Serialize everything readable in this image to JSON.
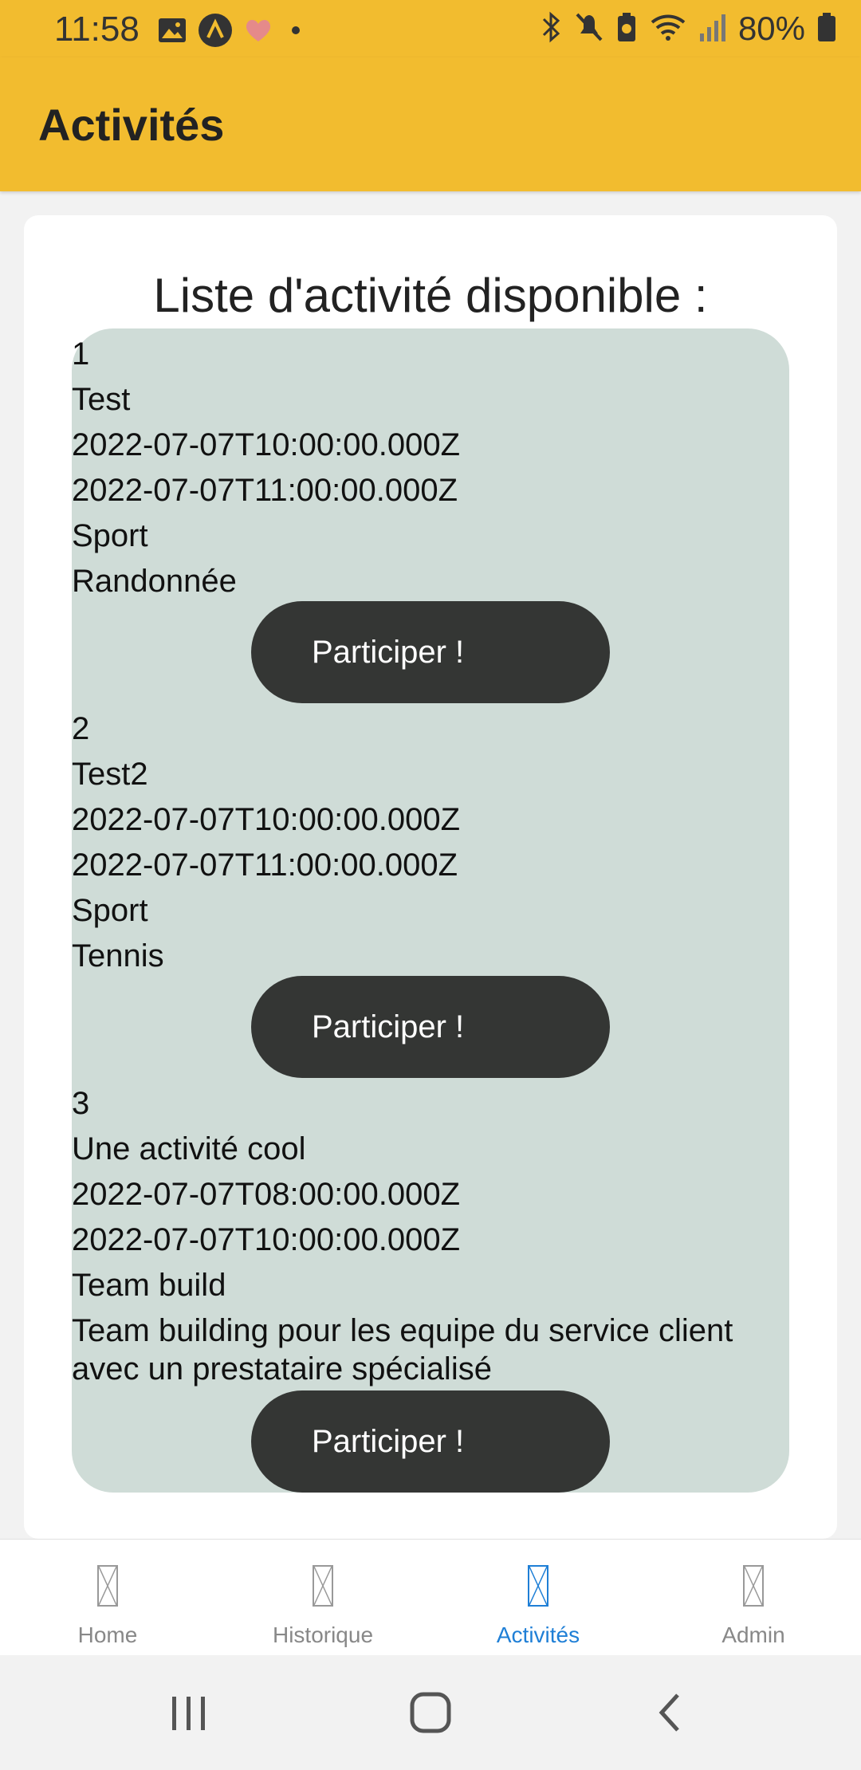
{
  "status_bar": {
    "time": "11:58",
    "battery_percent": "80%",
    "left_icons": [
      "image-icon",
      "app-icon",
      "heart-icon",
      "dot-icon"
    ],
    "right_icons": [
      "bluetooth-icon",
      "mute-icon",
      "battery-saver-icon",
      "wifi-icon",
      "signal-icon",
      "battery-icon"
    ]
  },
  "header": {
    "title": "Activités"
  },
  "main": {
    "list_title": "Liste d'activité disponible :",
    "button_label": "Participer !",
    "activities": [
      {
        "id": "1",
        "name": "Test",
        "start": "2022-07-07T10:00:00.000Z",
        "end": "2022-07-07T11:00:00.000Z",
        "category": "Sport",
        "description": "Randonnée"
      },
      {
        "id": "2",
        "name": "Test2",
        "start": "2022-07-07T10:00:00.000Z",
        "end": "2022-07-07T11:00:00.000Z",
        "category": "Sport",
        "description": "Tennis"
      },
      {
        "id": "3",
        "name": "Une activité cool",
        "start": "2022-07-07T08:00:00.000Z",
        "end": "2022-07-07T10:00:00.000Z",
        "category": "Team build",
        "description": "Team building pour les equipe du service client avec un prestataire spécialisé"
      }
    ]
  },
  "tabbar": {
    "tabs": [
      {
        "label": "Home",
        "active": false
      },
      {
        "label": "Historique",
        "active": false
      },
      {
        "label": "Activités",
        "active": true
      },
      {
        "label": "Admin",
        "active": false
      }
    ]
  },
  "colors": {
    "header_bg": "#f2bc2f",
    "list_bg": "#cfdcd7",
    "button_bg": "#343634",
    "active_tab": "#1f7fd6"
  }
}
